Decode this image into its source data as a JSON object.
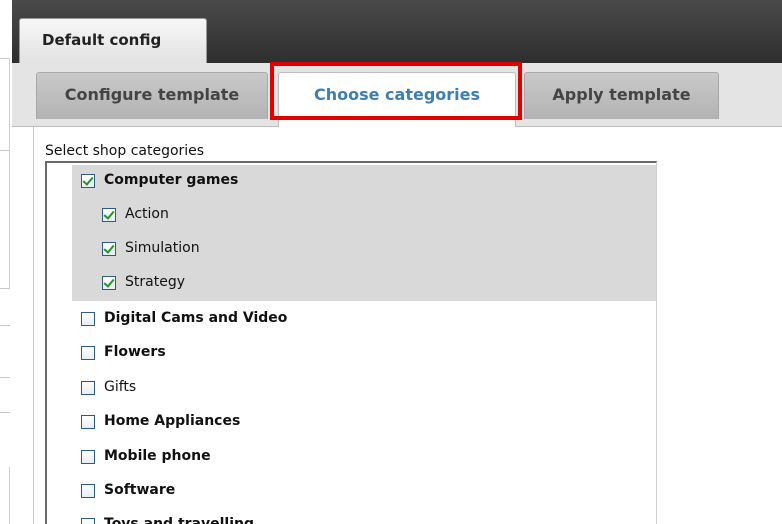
{
  "window": {
    "top_tab_label": "Default config"
  },
  "tabs": [
    {
      "label": "Configure template",
      "active": false
    },
    {
      "label": "Choose categories",
      "active": true
    },
    {
      "label": "Apply template",
      "active": false
    }
  ],
  "categories_section": {
    "label": "Select shop categories",
    "items": [
      {
        "label": "Computer games",
        "checked": true,
        "bold": true,
        "level": 0
      },
      {
        "label": "Action",
        "checked": true,
        "bold": false,
        "level": 1
      },
      {
        "label": "Simulation",
        "checked": true,
        "bold": false,
        "level": 1
      },
      {
        "label": "Strategy",
        "checked": true,
        "bold": false,
        "level": 1
      },
      {
        "label": "Digital Cams and Video",
        "checked": false,
        "bold": true,
        "level": 0
      },
      {
        "label": "Flowers",
        "checked": false,
        "bold": true,
        "level": 0
      },
      {
        "label": "Gifts",
        "checked": false,
        "bold": false,
        "level": 0
      },
      {
        "label": "Home Appliances",
        "checked": false,
        "bold": true,
        "level": 0
      },
      {
        "label": "Mobile phone",
        "checked": false,
        "bold": true,
        "level": 0
      },
      {
        "label": "Software",
        "checked": false,
        "bold": true,
        "level": 0
      },
      {
        "label": "Toys and travelling",
        "checked": false,
        "bold": true,
        "level": 0
      }
    ]
  },
  "colors": {
    "header_dark": "#3a3a3a",
    "active_tab_text": "#3d7fb5",
    "highlight": "#e00000",
    "selected_row": "#d9d9d9",
    "checkmark": "#229522"
  }
}
